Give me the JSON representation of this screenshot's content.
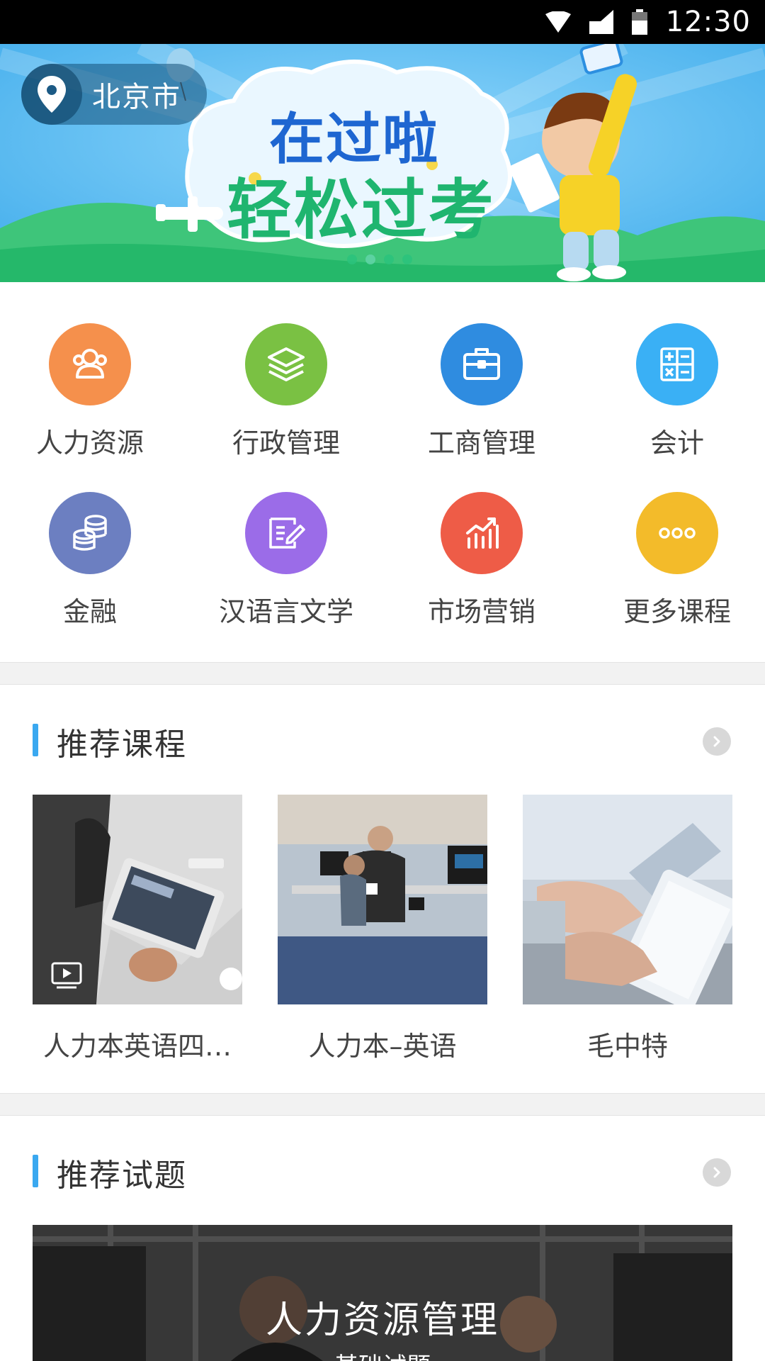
{
  "status_bar": {
    "time": "12:30"
  },
  "banner": {
    "location": "北京市",
    "headline_1": "在过啦",
    "headline_2": "轻松过考",
    "slide_count": 4,
    "active_slide": 2
  },
  "categories": [
    {
      "label": "人力资源",
      "icon": "people-icon",
      "color": "#f5904c"
    },
    {
      "label": "行政管理",
      "icon": "layers-icon",
      "color": "#7ac143"
    },
    {
      "label": "工商管理",
      "icon": "briefcase-icon",
      "color": "#2f8ce0"
    },
    {
      "label": "会计",
      "icon": "calculator-icon",
      "color": "#3ab0f5"
    },
    {
      "label": "金融",
      "icon": "coins-icon",
      "color": "#6c7fc1"
    },
    {
      "label": "汉语言文学",
      "icon": "writing-icon",
      "color": "#9b6ce8"
    },
    {
      "label": "市场营销",
      "icon": "growth-chart-icon",
      "color": "#ee5c47"
    },
    {
      "label": "更多课程",
      "icon": "more-icon",
      "color": "#f3bb2a"
    }
  ],
  "recommended_courses": {
    "title": "推荐课程",
    "items": [
      {
        "title": "人力本英语四…"
      },
      {
        "title": "人力本–英语"
      },
      {
        "title": "毛中特"
      }
    ]
  },
  "recommended_exams": {
    "title": "推荐试题",
    "card_title": "人力资源管理",
    "card_subtitle": "——基础试题——"
  },
  "colors": {
    "accent": "#3aa8f0",
    "banner_sky": "#4ab6ef",
    "banner_grass": "#2bc27c"
  }
}
